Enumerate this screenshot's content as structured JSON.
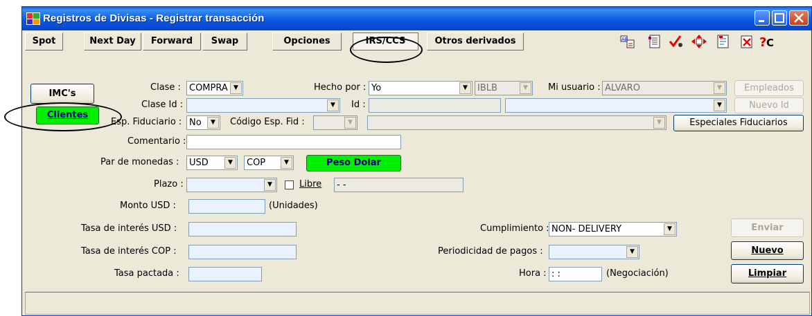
{
  "window": {
    "title": "Registros de Divisas - Registrar transacción"
  },
  "tabs": [
    {
      "label": "Spot"
    },
    {
      "label": "Next Day"
    },
    {
      "label": "Forward"
    },
    {
      "label": "Swap"
    },
    {
      "label": "Opciones"
    },
    {
      "label": "IRS/CCS"
    },
    {
      "label": "Otros derivados"
    }
  ],
  "side_buttons": {
    "imcs": "IMC's",
    "clientes": "Clientes"
  },
  "form": {
    "clase_label": "Clase :",
    "clase_value": "COMPRA",
    "hecho_por_label": "Hecho por :",
    "hecho_por_value": "Yo",
    "hecho_por_code": "IBLB",
    "mi_usuario_label": "Mi usuario :",
    "mi_usuario_value": "ALVARO",
    "empleados_button": "Empleados",
    "clase_id_label": "Clase Id :",
    "id_label": "Id :",
    "nuevo_id_button": "Nuevo Id",
    "esp_fiduciario_label": "Esp. Fiduciario :",
    "esp_fiduciario_value": "No",
    "codigo_esp_fid_label": "Código Esp. Fid :",
    "especiales_fiduciarios_button": "Especiales Fiduciarios",
    "comentario_label": "Comentario :",
    "par_monedas_label": "Par de monedas :",
    "moneda1": "USD",
    "moneda2": "COP",
    "peso_dolar_button": "Peso Dolar",
    "plazo_label": "Plazo :",
    "libre_label": "Libre",
    "plazo_fecha": " -  -",
    "monto_label": "Monto USD :",
    "unidades_label": "(Unidades)",
    "tasa_usd_label": "Tasa de interés USD :",
    "tasa_cop_label": "Tasa de interés COP :",
    "tasa_pactada_label": "Tasa pactada :",
    "cumplimiento_label": "Cumplimiento :",
    "cumplimiento_value": "NON- DELIVERY",
    "periodicidad_label": "Periodicidad de pagos :",
    "hora_label": "Hora :",
    "hora_value": " :  :",
    "negociacion_label": "(Negociación)"
  },
  "action_buttons": {
    "enviar": "Enviar",
    "nuevo": "Nuevo",
    "limpiar": "Limpiar"
  },
  "toolbar_icons": [
    "swap-currency-icon",
    "document-list-icon",
    "check-validate-icon",
    "move-arrows-icon",
    "report-icon",
    "delete-document-icon",
    "help-cursor-icon"
  ],
  "colors": {
    "title_blue": "#0b5ae2",
    "highlight_green": "#00ee00",
    "window_bg": "#ece9d8"
  }
}
